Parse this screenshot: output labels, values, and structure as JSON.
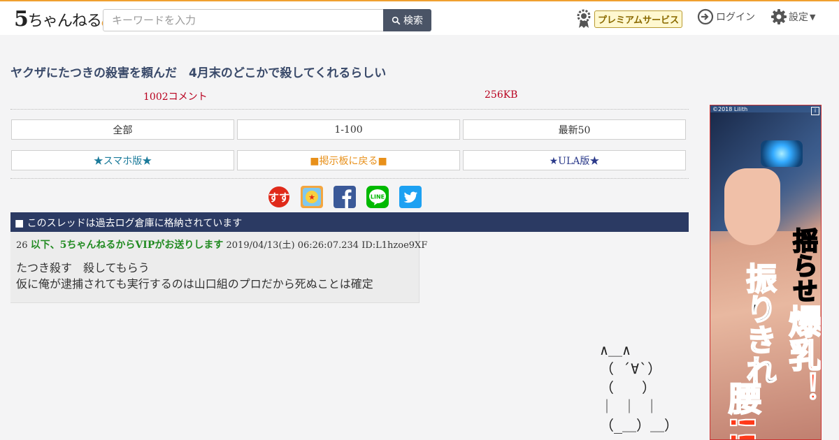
{
  "header": {
    "logo_text": "5ちゃんねる",
    "search_placeholder": "キーワードを入力",
    "search_button": "検索",
    "premium_label": "プレミアムサービス",
    "login_label": "ログイン",
    "settings_label": "設定"
  },
  "thread": {
    "title": "ヤクザにたつきの殺害を頼んだ　4月末のどこかで殺してくれるらしい",
    "comments": "1002コメント",
    "size": "256KB"
  },
  "nav": {
    "row1": [
      "全部",
      "1-100",
      "最新50"
    ],
    "row2": [
      "★スマホ版★",
      "■掲示板に戻る■",
      "★ULA版★"
    ]
  },
  "share_icons": [
    "sukuzu-icon",
    "bookmark-icon",
    "facebook-icon",
    "line-icon",
    "twitter-icon"
  ],
  "archived_notice": "■ このスレッドは過去ログ倉庫に格納されています",
  "post": {
    "number": "26",
    "name": "以下、5ちゃんねるからVIPがお送りします",
    "datetime": "2019/04/13(土) 06:26:07.234",
    "id": "ID:L1hzoe9XF",
    "lines": [
      "たつき殺す　殺してもらう",
      "仮に俺が逮捕されても実行するのは山口組のプロだから死ぬことは確定"
    ]
  },
  "ascii_art": "∧＿∧\n（ ´∀`）\n（　　）\n｜ ｜ ｜\n（_＿）＿）",
  "ad": {
    "copyright": "©2018 Lilith",
    "text1": "揺らせ",
    "text2": "爆乳！",
    "text3": "振りきれ",
    "text4": "腰!!"
  },
  "colors": {
    "accent": "#f0a030",
    "thread_title": "#3a4a6a",
    "meta_red": "#b8001e",
    "notice_bar": "#2b3a63",
    "post_name": "#228b22",
    "nav_teal": "#1a7a9a",
    "nav_orange": "#e8901a",
    "nav_blue": "#2b3a8a"
  }
}
